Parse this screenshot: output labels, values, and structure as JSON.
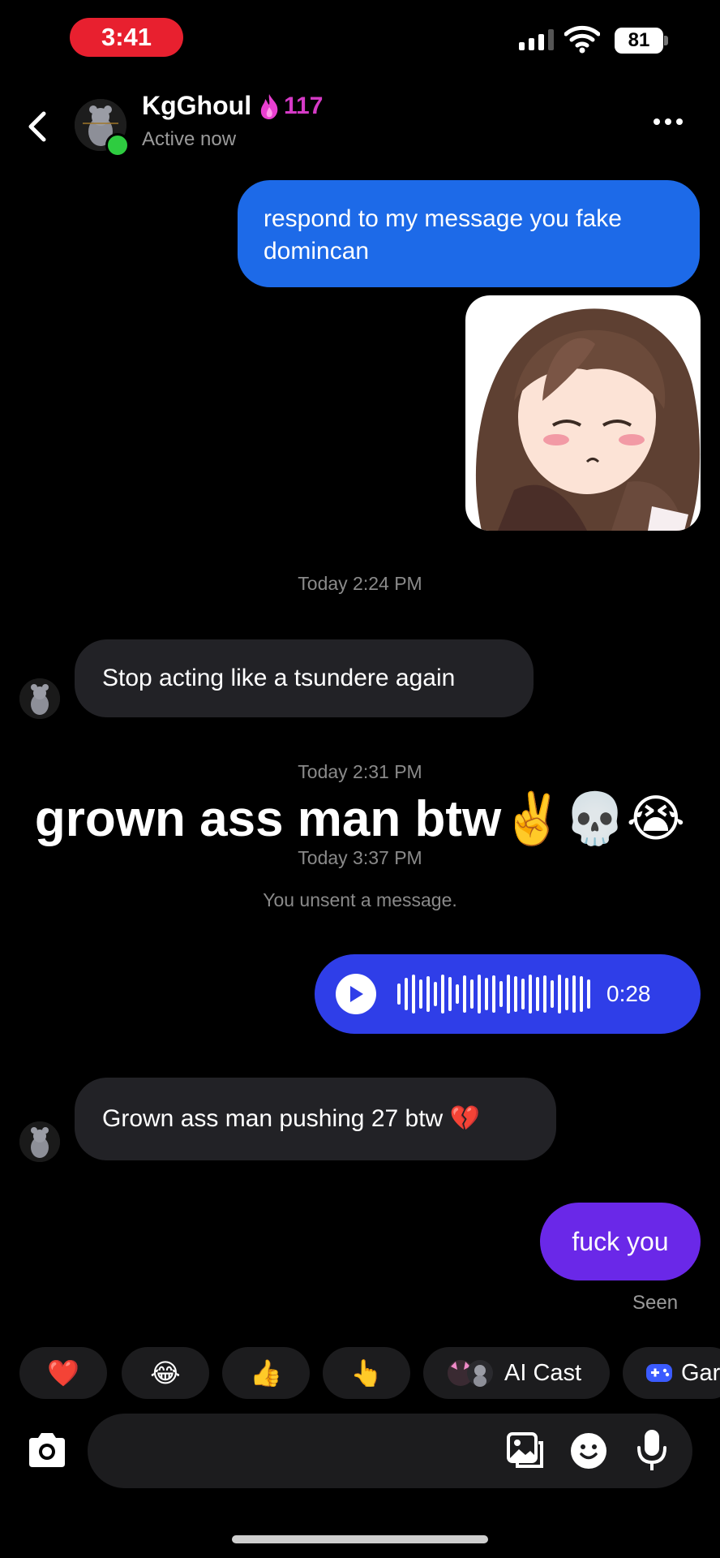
{
  "status_bar": {
    "time": "3:41",
    "battery": "81"
  },
  "header": {
    "name": "KgGhoul",
    "streak": "117",
    "status": "Active now"
  },
  "messages": {
    "sent_1": "respond to my message you fake domincan",
    "stamp_1": "Today 2:24 PM",
    "recv_1": "Stop acting like a tsundere again",
    "stamp_2": "Today 2:31 PM",
    "stamp_3": "Today 3:37 PM",
    "unsent": "You unsent a message.",
    "voice_duration": "0:28",
    "recv_2": "Grown ass man pushing 27 btw 💔",
    "sent_2": "fuck you",
    "seen": "Seen"
  },
  "overlay_caption": "grown ass man btw✌️💀😭",
  "quick_reactions": {
    "heart": "❤️",
    "laugh": "😂",
    "thumbs": "👍",
    "point": "👆",
    "ai_cast": "AI Cast",
    "games": "Gar"
  },
  "colors": {
    "sent_blue": "#1d6ae8",
    "voice_blue": "#2f3ee8",
    "sent_purple": "#6a28e8",
    "received_gray": "#222226",
    "streak_pink": "#d53ac6",
    "time_pill_red": "#e8202f"
  }
}
